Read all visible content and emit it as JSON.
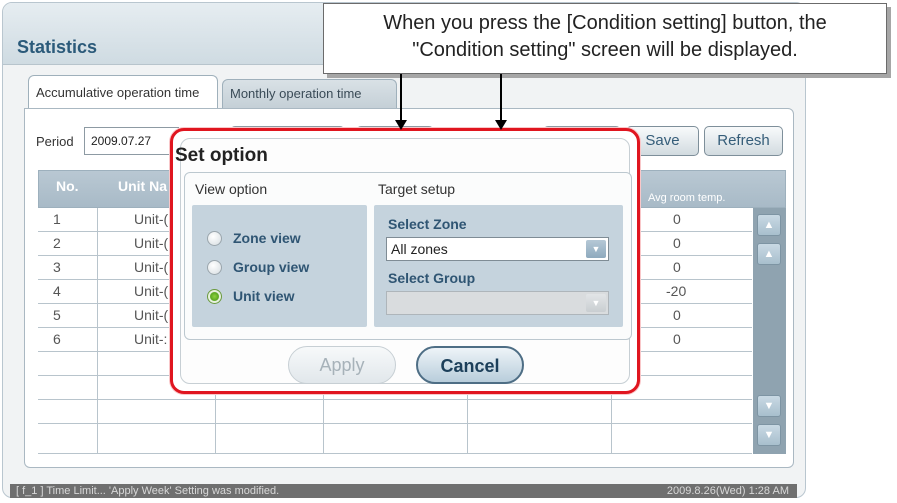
{
  "app": {
    "title": "Statistics"
  },
  "tabs": [
    {
      "label": "Accumulative operation time"
    },
    {
      "label": "Monthly operation time"
    }
  ],
  "toolbar": {
    "period_label": "Period",
    "period_value": "2009.07.27",
    "save_label": "Save",
    "refresh_label": "Refresh"
  },
  "table": {
    "headers": [
      "No.",
      "Unit Na",
      "Avg room temp."
    ],
    "rows": [
      {
        "no": "1",
        "unit": "Unit-(",
        "avg": "0"
      },
      {
        "no": "2",
        "unit": "Unit-(",
        "avg": "0"
      },
      {
        "no": "3",
        "unit": "Unit-(",
        "avg": "0"
      },
      {
        "no": "4",
        "unit": "Unit-(",
        "avg": "-20"
      },
      {
        "no": "5",
        "unit": "Unit-(",
        "avg": "0"
      },
      {
        "no": "6",
        "unit": "Unit-:",
        "avg": "0"
      }
    ]
  },
  "dialog": {
    "title": "Set option",
    "view_option_label": "View option",
    "target_setup_label": "Target setup",
    "radios": [
      {
        "label": "Zone view",
        "checked": false
      },
      {
        "label": "Group view",
        "checked": false
      },
      {
        "label": "Unit view",
        "checked": true
      }
    ],
    "select_zone_label": "Select Zone",
    "select_zone_value": "All zones",
    "select_group_label": "Select Group",
    "select_group_value": "",
    "apply_label": "Apply",
    "cancel_label": "Cancel"
  },
  "callout": {
    "line1": "When you press the [Condition setting] button, the",
    "line2": "\"Condition setting\" screen will be displayed."
  },
  "status": {
    "message": "[ f_1 ] Time Limit... 'Apply Week' Setting was modified.",
    "datetime": "2009.8.26(Wed) 1:28 AM"
  },
  "colors": {
    "highlight_border": "#e0151f",
    "accent": "#2f5573",
    "table_header": "#a8bac7"
  }
}
